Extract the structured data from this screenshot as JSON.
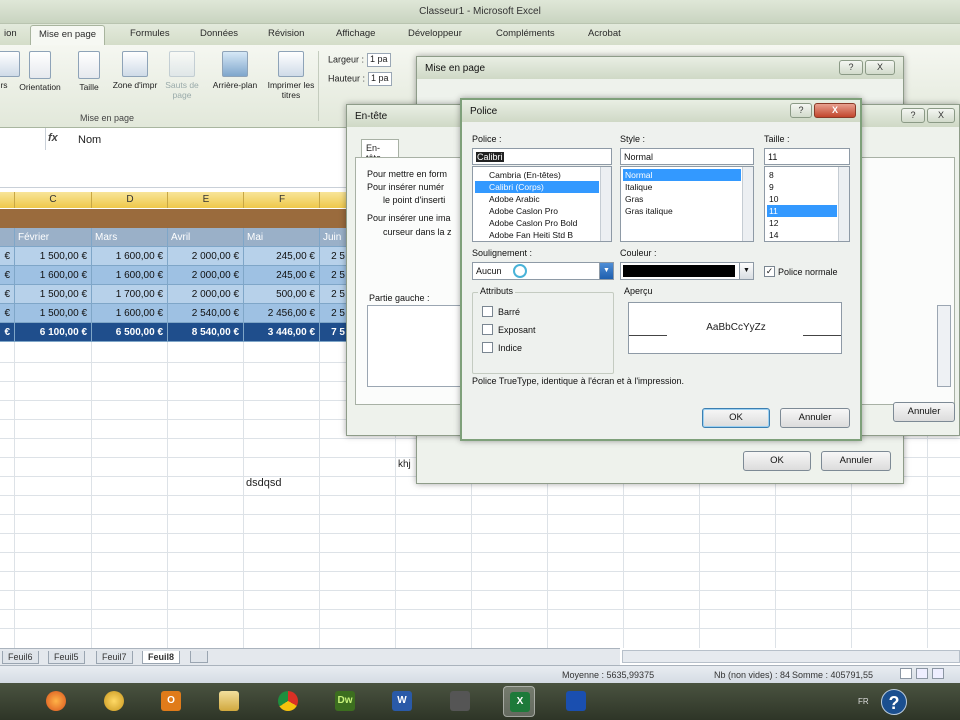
{
  "window": {
    "title": "Classeur1 - Microsoft Excel"
  },
  "ribbon_tabs": [
    {
      "label": "ion"
    },
    {
      "label": "Mise en page"
    },
    {
      "label": "Formules"
    },
    {
      "label": "Données"
    },
    {
      "label": "Révision"
    },
    {
      "label": "Affichage"
    },
    {
      "label": "Développeur"
    },
    {
      "label": "Compléments"
    },
    {
      "label": "Acrobat"
    }
  ],
  "ribbon": {
    "buttons": [
      {
        "label": "rs"
      },
      {
        "label": "Orientation"
      },
      {
        "label": "Taille"
      },
      {
        "label": "Zone d'impr"
      },
      {
        "label": "Sauts de page"
      },
      {
        "label": "Arrière-plan"
      },
      {
        "label": "Imprimer les titres"
      }
    ],
    "group_label": "Mise en page",
    "width_label": "Largeur :",
    "width_value": "1 pa",
    "height_label": "Hauteur :",
    "height_value": "1 pa"
  },
  "formula_bar": {
    "fx": "fx",
    "value": "Nom"
  },
  "sheet": {
    "columns": [
      "C",
      "D",
      "E",
      "F"
    ],
    "header_row": [
      "Février",
      "Mars",
      "Avril",
      "Mai",
      "Juin"
    ],
    "rows": [
      [
        "€",
        "1 500,00 €",
        "1 600,00 €",
        "2 000,00 €",
        "245,00 €",
        "2 5"
      ],
      [
        "€",
        "1 600,00 €",
        "1 600,00 €",
        "2 000,00 €",
        "245,00 €",
        "2 5"
      ],
      [
        "€",
        "1 500,00 €",
        "1 700,00 €",
        "2 000,00 €",
        "500,00 €",
        "2 5"
      ],
      [
        "€",
        "1 500,00 €",
        "1 600,00 €",
        "2 540,00 €",
        "2 456,00 €",
        "2 5"
      ]
    ],
    "total_row": [
      "€",
      "6 100,00 €",
      "6 500,00 €",
      "8 540,00 €",
      "3 446,00 €",
      "7 5"
    ],
    "text_dsdqsd": "dsdqsd",
    "text_khj": "khj"
  },
  "sheet_tabs": [
    {
      "label": "Feuil6"
    },
    {
      "label": "Feuil5"
    },
    {
      "label": "Feuil7"
    },
    {
      "label": "Feuil8"
    }
  ],
  "status": {
    "average": "Moyenne : 5635,99375",
    "count": "Nb (non vides) : 84",
    "sum": "Somme : 405791,55"
  },
  "taskbar": {
    "apps": [
      "firefox-icon",
      "media-icon",
      "outlook-icon",
      "explorer-icon",
      "chrome-icon",
      "dreamweaver-icon",
      "word-icon",
      "tool-icon",
      "excel-icon",
      "app-icon"
    ],
    "dw_text": "Dw",
    "word_text": "W",
    "lang": "FR",
    "help": "?"
  },
  "dialog_mise_en_page": {
    "title": "Mise en page",
    "ok": "OK",
    "cancel": "Annuler",
    "help_btn": "?",
    "close_btn": "X"
  },
  "dialog_entete": {
    "title": "En-tête",
    "tab": "En-tête",
    "instructions": [
      "Pour mettre en form",
      "Pour insérer numér",
      "le point d'inserti",
      "Pour insérer une ima",
      "curseur dans la z"
    ],
    "left_part_label": "Partie gauche :",
    "cancel": "Annuler",
    "help_btn": "?",
    "close_btn": "X"
  },
  "dialog_police": {
    "title": "Police",
    "font_label": "Police :",
    "font_value": "Calibri",
    "fonts": [
      {
        "name": "Cambria (En-têtes)",
        "selected": false
      },
      {
        "name": "Calibri (Corps)",
        "selected": true
      },
      {
        "name": "Adobe Arabic",
        "selected": false
      },
      {
        "name": "Adobe Caslon Pro",
        "selected": false
      },
      {
        "name": "Adobe Caslon Pro Bold",
        "selected": false
      },
      {
        "name": "Adobe Fan Heiti Std B",
        "selected": false
      }
    ],
    "style_label": "Style :",
    "style_value": "Normal",
    "styles": [
      {
        "name": "Normal",
        "selected": true
      },
      {
        "name": "Italique",
        "selected": false
      },
      {
        "name": "Gras",
        "selected": false
      },
      {
        "name": "Gras italique",
        "selected": false
      }
    ],
    "size_label": "Taille :",
    "size_value": "11",
    "sizes": [
      {
        "name": "8",
        "selected": false
      },
      {
        "name": "9",
        "selected": false
      },
      {
        "name": "10",
        "selected": false
      },
      {
        "name": "11",
        "selected": true
      },
      {
        "name": "12",
        "selected": false
      },
      {
        "name": "14",
        "selected": false
      }
    ],
    "underline_label": "Soulignement :",
    "underline_value": "Aucun",
    "color_label": "Couleur :",
    "color_value": "#000000",
    "normal_font_label": "Police normale",
    "attributes_label": "Attributs",
    "attributes": [
      {
        "label": "Barré"
      },
      {
        "label": "Exposant"
      },
      {
        "label": "Indice"
      }
    ],
    "preview_label": "Aperçu",
    "preview_text": "AaBbCcYyZz",
    "info": "Police TrueType, identique à l'écran et à l'impression.",
    "ok": "OK",
    "cancel": "Annuler",
    "help_btn": "?",
    "close_btn": "X"
  }
}
